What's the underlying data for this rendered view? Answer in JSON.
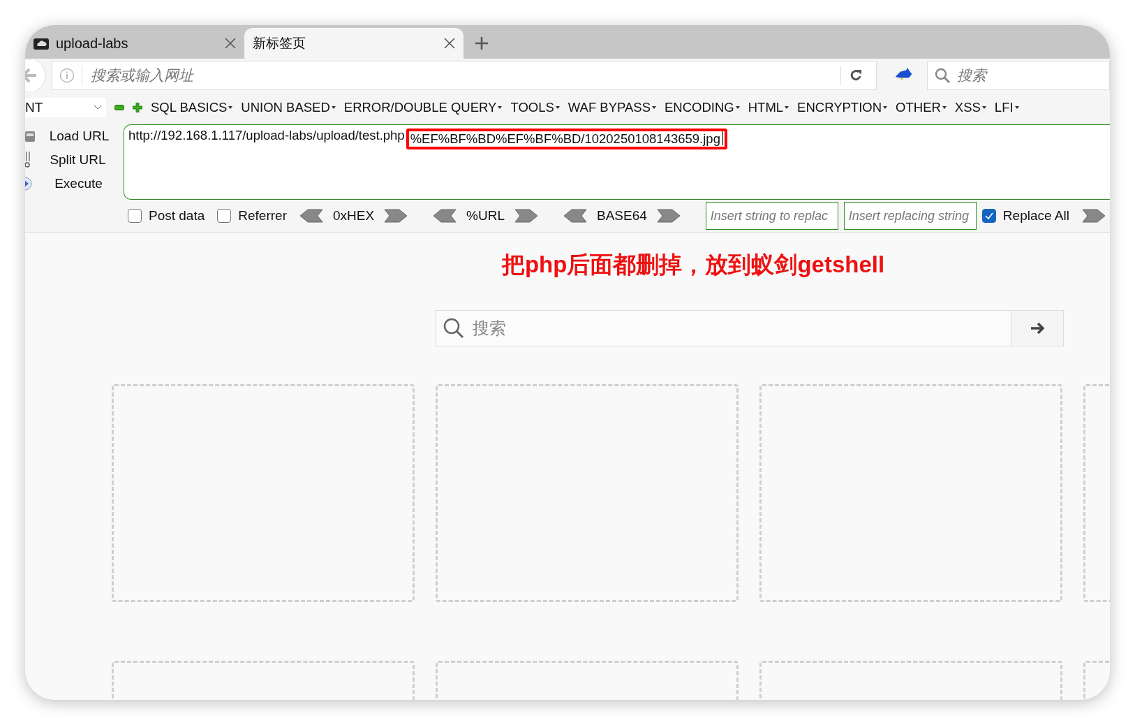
{
  "tabs": [
    {
      "title": "upload-labs",
      "selected": false
    },
    {
      "title": "新标签页",
      "selected": true
    }
  ],
  "nav": {
    "address_placeholder": "搜索或输入网址",
    "search_placeholder": "搜索"
  },
  "hackbar": {
    "dropdown": "NT",
    "menus": [
      "SQL BASICS",
      "UNION BASED",
      "ERROR/DOUBLE QUERY",
      "TOOLS",
      "WAF BYPASS",
      "ENCODING",
      "HTML",
      "ENCRYPTION",
      "OTHER",
      "XSS",
      "LFI"
    ],
    "actions": [
      {
        "kind": "load",
        "label": "Load URL"
      },
      {
        "kind": "split",
        "label": "Split URL"
      },
      {
        "kind": "execute",
        "label": "Execute"
      }
    ],
    "url": {
      "text": "http://192.168.1.117/upload-labs/upload/test.php",
      "highlighted": "%EF%BF%BD%EF%BF%BD/1020250108143659.jpg"
    },
    "options": [
      {
        "label": "Post data",
        "checked": false
      },
      {
        "label": "Referrer",
        "checked": false
      }
    ],
    "encoders": [
      "0xHEX",
      "%URL",
      "BASE64"
    ],
    "replace_from_placeholder": "Insert string to replac",
    "replace_to_placeholder": "Insert replacing string",
    "replace_all": {
      "label": "Replace All",
      "checked": true
    }
  },
  "annotation": "把php后面都删掉，放到蚁剑getshell",
  "page_search": {
    "placeholder": "搜索"
  }
}
